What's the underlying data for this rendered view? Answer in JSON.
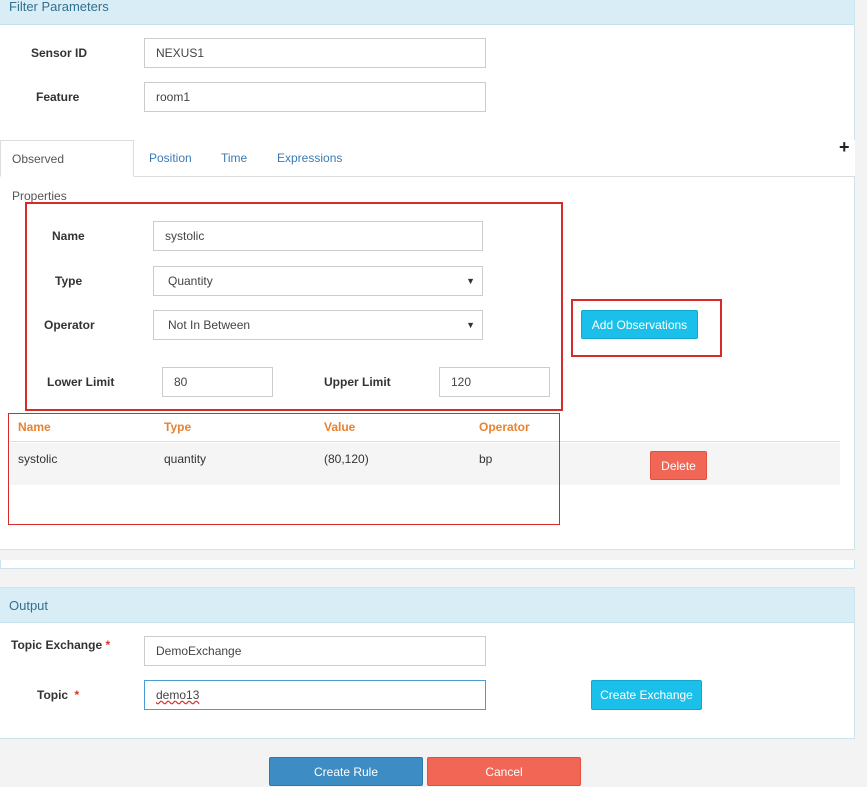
{
  "filter": {
    "title": "Filter Parameters",
    "sensor_id_label": "Sensor ID",
    "sensor_id_value": "NEXUS1",
    "feature_label": "Feature",
    "feature_value": "room1"
  },
  "tabs": [
    {
      "label": "Observed Properties",
      "active": true
    },
    {
      "label": "Position",
      "active": false
    },
    {
      "label": "Time",
      "active": false
    },
    {
      "label": "Expressions",
      "active": false
    }
  ],
  "plus_icon": "+",
  "observation_form": {
    "name_label": "Name",
    "name_value": "systolic",
    "type_label": "Type",
    "type_value": "Quantity",
    "operator_label": "Operator",
    "operator_value": "Not In Between",
    "lower_label": "Lower Limit",
    "lower_value": "80",
    "upper_label": "Upper Limit",
    "upper_value": "120",
    "add_button": "Add Observations"
  },
  "observations_table": {
    "headers": [
      "Name",
      "Type",
      "Value",
      "Operator"
    ],
    "rows": [
      {
        "name": "systolic",
        "type": "quantity",
        "value": "(80,120)",
        "operator": "bp",
        "action": "Delete"
      }
    ]
  },
  "output": {
    "title": "Output",
    "exchange_label": "Topic Exchange",
    "exchange_value": "DemoExchange",
    "topic_label": "Topic",
    "topic_value": "demo13",
    "required_mark": "*",
    "create_exchange_button": "Create Exchange"
  },
  "footer": {
    "create_rule_button": "Create Rule",
    "cancel_button": "Cancel"
  },
  "colors": {
    "panel_heading": "#d9edf7",
    "info": "#1ac0e9",
    "danger": "#f26655",
    "primary": "#3d8cc4",
    "table_header": "#e8822f",
    "highlight_box": "#d62b2b"
  }
}
